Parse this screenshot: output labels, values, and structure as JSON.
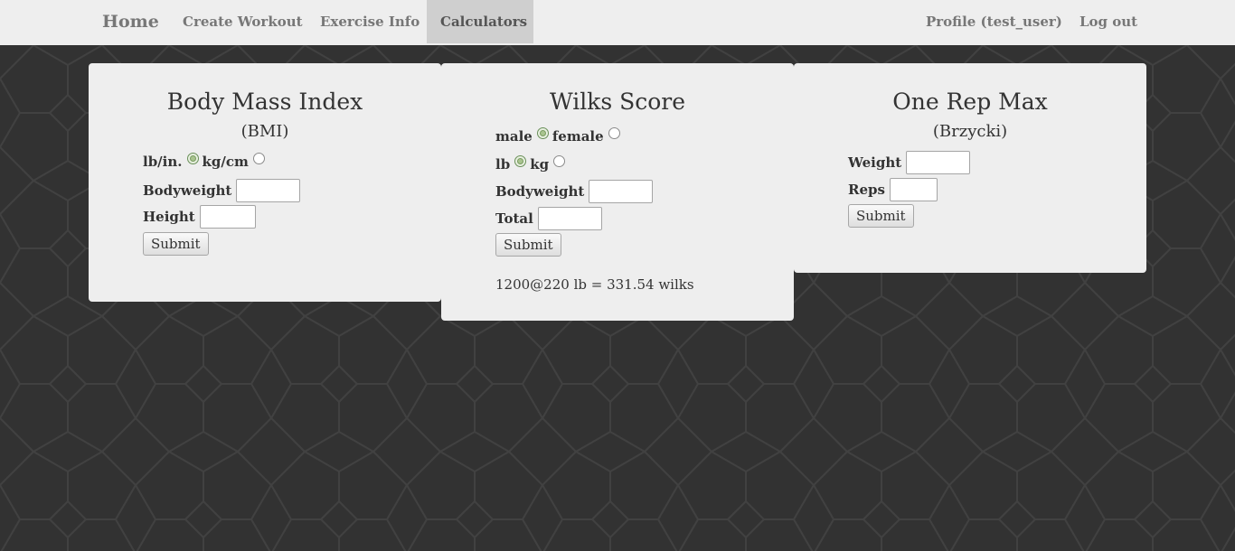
{
  "nav": {
    "home": "Home",
    "create_workout": "Create Workout",
    "exercise_info": "Exercise Info",
    "calculators": "Calculators",
    "profile": "Profile (test_user)",
    "logout": "Log out"
  },
  "bmi": {
    "title": "Body Mass Index",
    "subtitle": "(BMI)",
    "unit_imperial": "lb/in.",
    "unit_metric": "kg/cm",
    "selected_unit": "lb/in.",
    "bodyweight_label": "Bodyweight",
    "bodyweight_value": "",
    "height_label": "Height",
    "height_value": "",
    "submit_label": "Submit"
  },
  "wilks": {
    "title": "Wilks Score",
    "sex_male": "male",
    "sex_female": "female",
    "selected_sex": "male",
    "unit_lb": "lb",
    "unit_kg": "kg",
    "selected_unit": "lb",
    "bodyweight_label": "Bodyweight",
    "bodyweight_value": "",
    "total_label": "Total",
    "total_value": "",
    "submit_label": "Submit",
    "result": "1200@220 lb = 331.54 wilks"
  },
  "orm": {
    "title": "One Rep Max",
    "subtitle": "(Brzycki)",
    "weight_label": "Weight",
    "weight_value": "",
    "reps_label": "Reps",
    "reps_value": "",
    "submit_label": "Submit"
  },
  "colors": {
    "page_background": "#323232",
    "pattern_stroke": "#404040",
    "navbar_background": "#eeeeee",
    "nav_active_background": "#cfcfcf",
    "card_background": "#eeeeee",
    "radio_selected": "#a9c48f"
  }
}
